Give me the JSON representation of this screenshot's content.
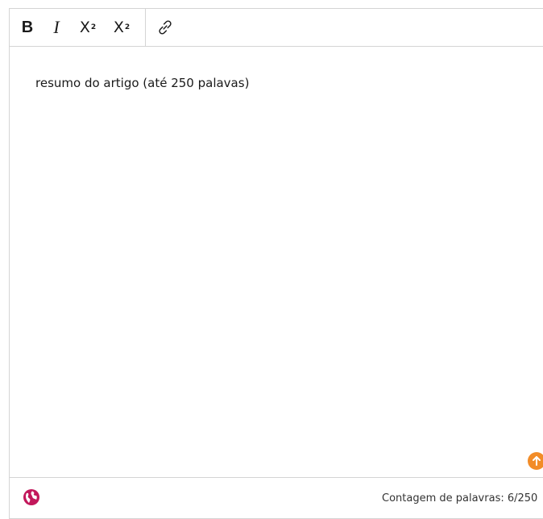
{
  "toolbar": {
    "bold_label": "B",
    "italic_label": "I",
    "superscript_base": "X",
    "superscript_mark": "2",
    "subscript_base": "X",
    "subscript_mark": "2"
  },
  "editor": {
    "content": "resumo do artigo (até 250 palavas)"
  },
  "footer": {
    "word_count": "Contagem de palavras: 6/250"
  },
  "colors": {
    "resize_handle": "#f28c28",
    "globe": "#c2185b",
    "border": "#d4d4d4"
  }
}
